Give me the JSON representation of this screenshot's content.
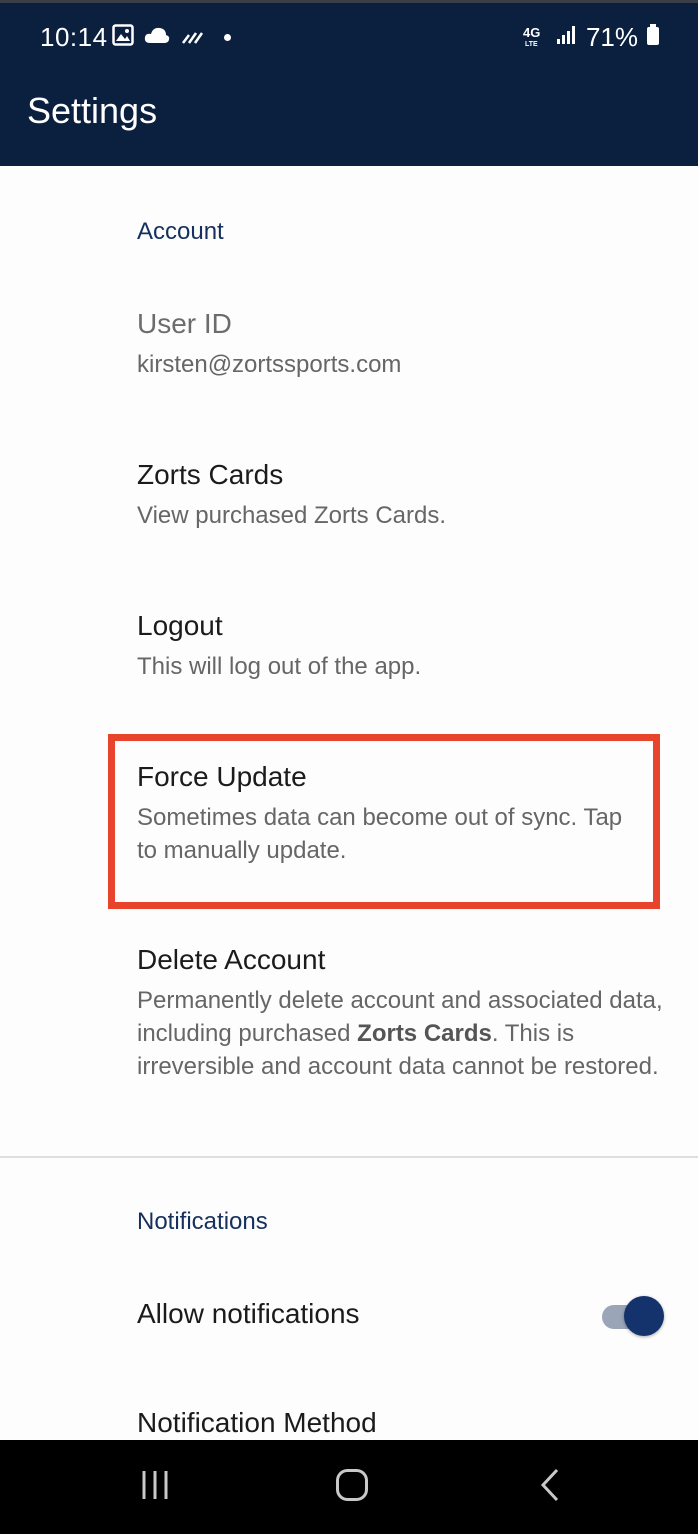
{
  "status_bar": {
    "time": "10:14",
    "battery": "71%",
    "icons": [
      "image-icon",
      "cloud-icon",
      "signal-bars-icon",
      "dot-icon",
      "lte-icon",
      "cellular-icon",
      "battery-icon"
    ]
  },
  "app_bar": {
    "title": "Settings"
  },
  "account": {
    "section_title": "Account",
    "user_id": {
      "title": "User ID",
      "summary": "kirsten@zortssports.com"
    },
    "zorts_cards": {
      "title": "Zorts Cards",
      "summary": "View purchased Zorts Cards."
    },
    "logout": {
      "title": "Logout",
      "summary": "This will log out of the app."
    },
    "force_update": {
      "title": "Force Update",
      "summary": "Sometimes data can become out of sync. Tap to manually update."
    },
    "delete_account": {
      "title": "Delete Account",
      "summary_before": "Permanently delete account and associated data, including purchased ",
      "summary_bold": "Zorts Cards",
      "summary_after": ". This is irreversible and account data cannot be restored."
    }
  },
  "notifications": {
    "section_title": "Notifications",
    "allow": {
      "title": "Allow notifications",
      "enabled": true
    },
    "method": {
      "title": "Notification Method"
    }
  },
  "nav_bar": {
    "icons": [
      "recents-icon",
      "home-icon",
      "back-icon"
    ]
  },
  "colors": {
    "app_bar": "#0b1f3f",
    "accent": "#16305e",
    "highlight": "#e8432b",
    "toggle_thumb": "#14326c"
  }
}
